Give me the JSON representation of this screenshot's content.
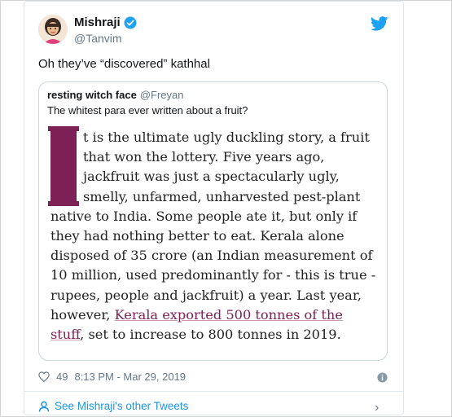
{
  "author": {
    "name": "Mishraji",
    "handle": "@Tanvim",
    "avatar_icon": "avatar-illustration",
    "verified_icon": "verified-badge-icon",
    "brand_icon": "twitter-bird-icon",
    "brand_color": "#1da1f2"
  },
  "tweet": {
    "text": "Oh they’ve “discovered” kathhal"
  },
  "quoted": {
    "name": "resting witch face",
    "handle": "@Freyan",
    "text": "The whitest para ever written about a fruit?",
    "article": {
      "drop_cap": "I",
      "lines": [
        "t is the ultimate ugly duckling story, a fruit",
        "that won the lottery. Five years ago,",
        "jackfruit was just a spectacularly ugly,",
        "smelly, unfarmed, unharvested pest-plant",
        "native to India. Some people ate it, but only if",
        "they had nothing better to eat. Kerala alone",
        "disposed of 35 crore (an Indian measurement of",
        "10 million, used predominantly for - this is true -",
        "rupees, people and jackfruit) a year. Last year,"
      ],
      "line_10_prefix": "however, ",
      "link_part_1": "Kerala exported 500 tonnes of the",
      "link_part_2": "stuff",
      "line_11_suffix": ", set to increase to 800 tonnes in 2019.",
      "accent_color": "#7d2056"
    }
  },
  "meta": {
    "likes": "49",
    "timestamp": "8:13 PM - Mar 29, 2019",
    "heart_icon": "heart-icon",
    "info_icon": "info-icon"
  },
  "footer": {
    "label": "See Mishraji's other Tweets",
    "user_icon": "user-icon",
    "chevron_icon": "chevron-right-icon"
  }
}
